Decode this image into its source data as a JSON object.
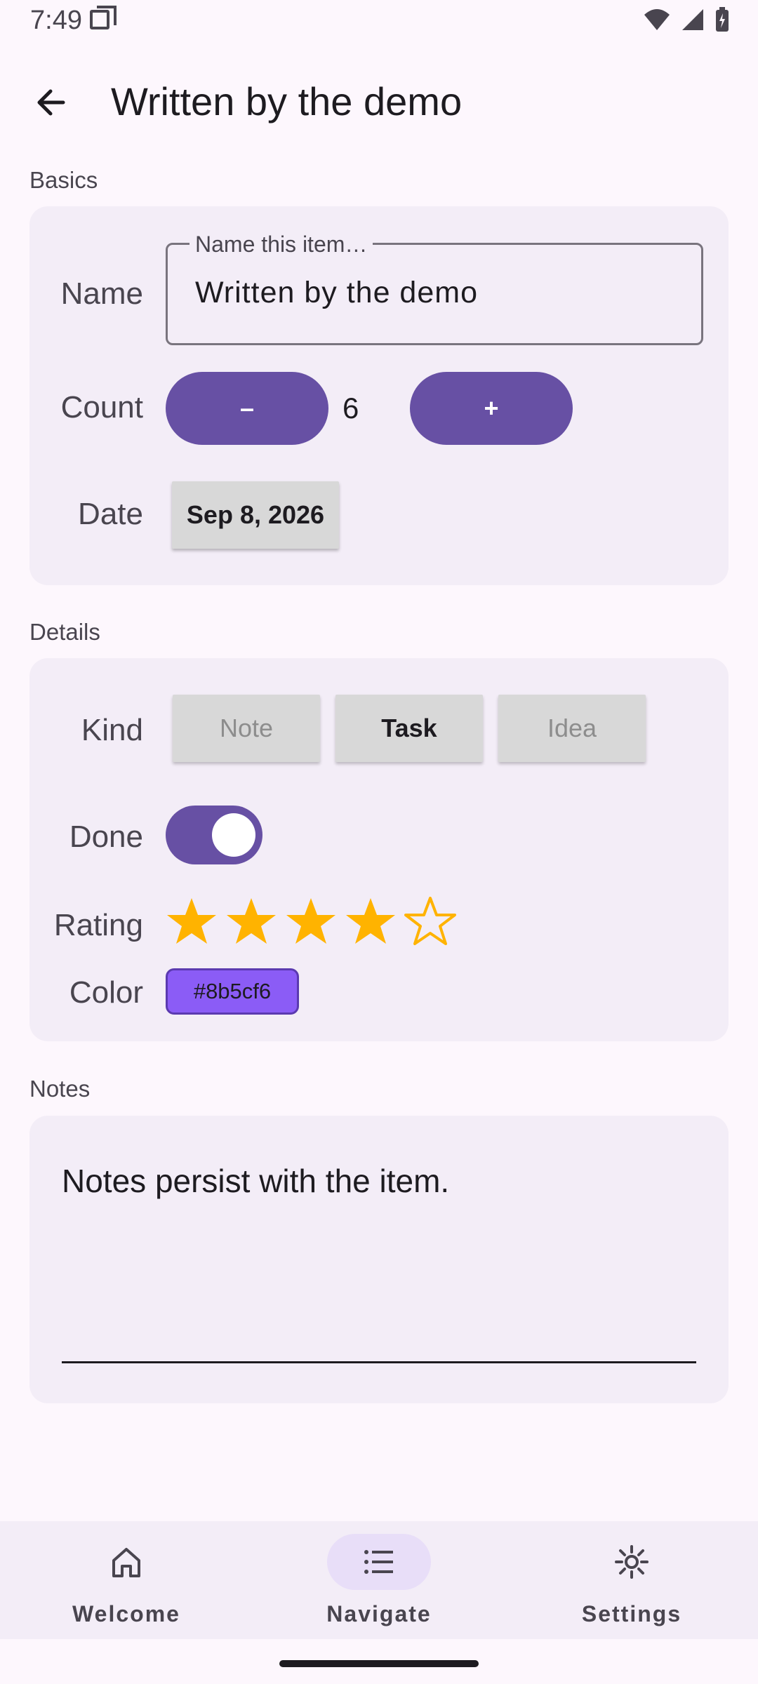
{
  "status_bar": {
    "time": "7:49"
  },
  "app_bar": {
    "title": "Written by the demo"
  },
  "basics": {
    "section_label": "Basics",
    "name_label": "Name",
    "name_legend": "Name this item…",
    "name_value": "Written by the demo",
    "count_label": "Count",
    "minus_label": "–",
    "count_value": "6",
    "plus_label": "+",
    "date_label": "Date",
    "date_value": "Sep 8, 2026"
  },
  "details": {
    "section_label": "Details",
    "kind_label": "Kind",
    "kinds": [
      "Note",
      "Task",
      "Idea"
    ],
    "selected_kind": "Task",
    "done_label": "Done",
    "done_on": true,
    "rating_label": "Rating",
    "rating": 4,
    "rating_max": 5,
    "color_label": "Color",
    "color_value": "#8b5cf6"
  },
  "notes": {
    "section_label": "Notes",
    "text": "Notes persist with the item."
  },
  "bottom_nav": {
    "items": [
      {
        "label": "Welcome",
        "icon": "home-icon"
      },
      {
        "label": "Navigate",
        "icon": "list-icon",
        "active": true
      },
      {
        "label": "Settings",
        "icon": "gear-icon"
      }
    ]
  },
  "colors": {
    "primary": "#6750a4",
    "star": "#ffb300",
    "surface": "#f3edf7",
    "background": "#fdf7fd"
  }
}
